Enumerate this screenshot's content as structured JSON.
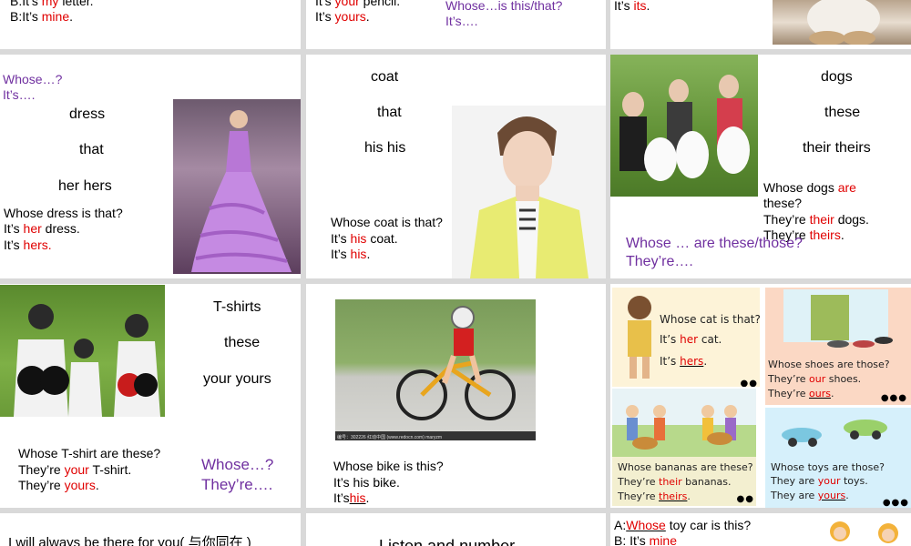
{
  "slides": {
    "s1": {
      "line1_a": "B:It’s ",
      "line1_b": "my",
      "line1_c": " letter.",
      "line2_a": "B:It’s ",
      "line2_b": "mine",
      "line2_c": "."
    },
    "s2": {
      "line1_a": "It’s ",
      "line1_b": "your",
      "line1_c": " pencil.",
      "line2_a": "It’s ",
      "line2_b": "yours",
      "line2_c": ".",
      "q": "Whose…is this/that?",
      "a": "It’s…."
    },
    "s3": {
      "line_a": "It’s ",
      "line_b": "its",
      "line_c": "."
    },
    "s4": {
      "q": "Whose…?",
      "a": "It’s….",
      "w1": "dress",
      "w2": "that",
      "w3": "her  hers",
      "l1": "Whose dress is that?",
      "l2a": "It’s ",
      "l2b": "her",
      "l2c": " dress.",
      "l3a": "It’s ",
      "l3b": "hers."
    },
    "s5": {
      "w1": "coat",
      "w2": "that",
      "w3": "his his",
      "l1": "Whose coat is that?",
      "l2a": "It’s ",
      "l2b": "his",
      "l2c": " coat.",
      "l3a": "It’s ",
      "l3b": "his",
      "l3c": "."
    },
    "s6": {
      "w1": "dogs",
      "w2": "these",
      "w3": "their theirs",
      "l1a": "Whose dogs ",
      "l1b": "are",
      "l2": "these?",
      "l3a": "They’re ",
      "l3b": "their",
      "l3c": " dogs.",
      "l4a": "They’re ",
      "l4b": "theirs",
      "l4c": ".",
      "q": "Whose … are these/those?",
      "a": "They’re…."
    },
    "s7": {
      "w1": "T-shirts",
      "w2": "these",
      "w3": "your yours",
      "l1": "Whose T-shirt are these?",
      "l2a": "They’re ",
      "l2b": "your",
      "l2c": " T-shirt.",
      "l3a": "They’re ",
      "l3b": "yours",
      "l3c": ".",
      "q": "Whose…?",
      "a": "They’re…."
    },
    "s8": {
      "l1": "Whose bike is this?",
      "l2": "It’s his bike.",
      "l3a": "It’s",
      "l3b": "his",
      "l3c": ".",
      "caption": "编号：302226  红动中国 (www.redocn.com)    maryzm"
    },
    "s9": {
      "p1": {
        "l1": "Whose cat is that?",
        "l2a": "It’s ",
        "l2b": "her",
        "l2c": " cat.",
        "l3a": "It’s ",
        "l3b": "hers",
        "l3c": "."
      },
      "p2": {
        "l1": "Whose shoes are those?",
        "l2a": "They’re ",
        "l2b": "our",
        "l2c": " shoes.",
        "l3a": "They’re ",
        "l3b": "ours",
        "l3c": "."
      },
      "p3": {
        "l1": "Whose bananas are these?",
        "l2a": "They’re ",
        "l2b": "their",
        "l2c": " bananas.",
        "l3a": "They’re ",
        "l3b": "theirs",
        "l3c": "."
      },
      "p4": {
        "l1": "Whose toys are those?",
        "l2a": "They are ",
        "l2b": "your",
        "l2c": " toys.",
        "l3a": "They are ",
        "l3b": "yours",
        "l3c": "."
      }
    },
    "s10": {
      "text": "I will always be there for you( 与你同在 )"
    },
    "s11": {
      "text": "Listen and number"
    },
    "s12": {
      "l1a": "A:",
      "l1b": "Whose",
      "l1c": " toy car is this?",
      "l2a": "B: It’s ",
      "l2b": "mine"
    }
  },
  "colors": {
    "purple": "#7030a0",
    "red": "#e00000",
    "grid": "#d9d9d9"
  }
}
